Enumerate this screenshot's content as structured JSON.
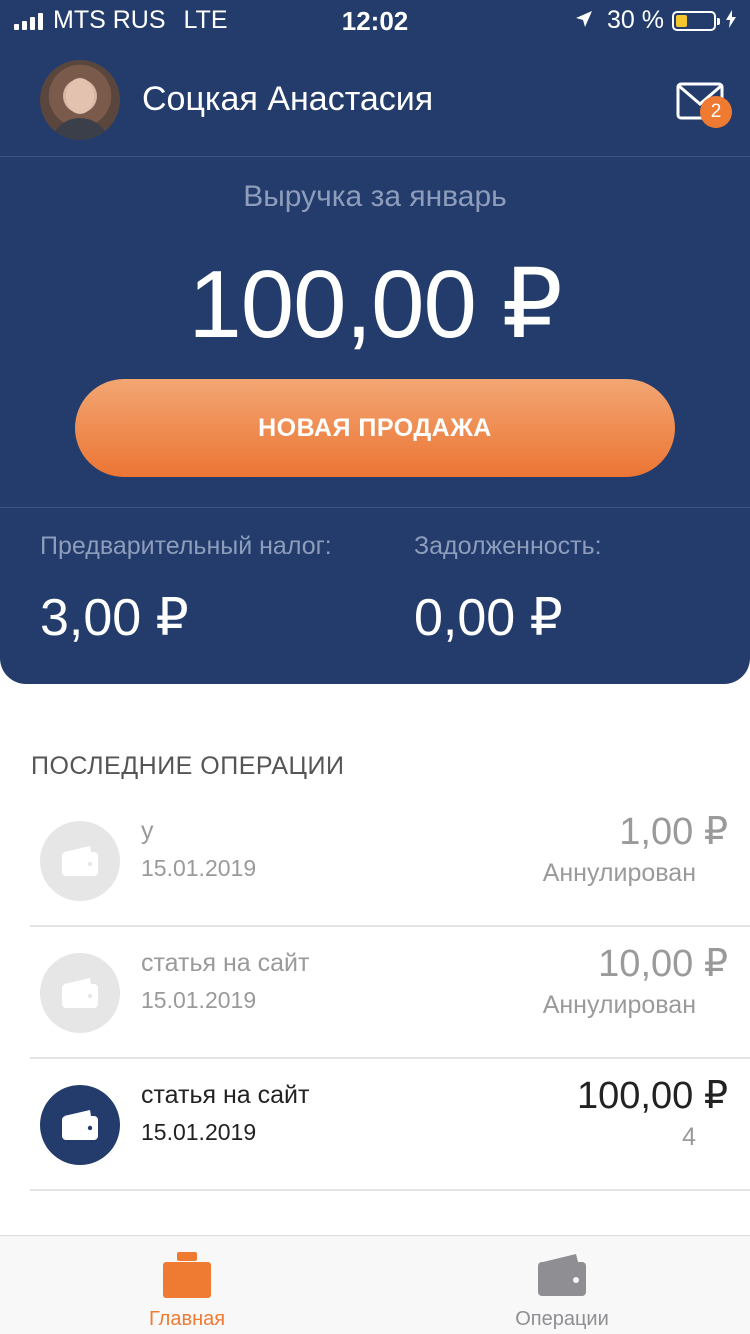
{
  "status_bar": {
    "carrier": "MTS RUS",
    "network": "LTE",
    "time": "12:02",
    "battery": "30 %",
    "battery_level": 0.3
  },
  "profile": {
    "name": "Соцкая Анастасия",
    "mail_badge": "2"
  },
  "revenue": {
    "label": "Выручка за январь",
    "amount": "100,00 ₽",
    "button_label": "НОВАЯ ПРОДАЖА"
  },
  "summary": {
    "tax_label": "Предварительный налог:",
    "tax_value": "3,00 ₽",
    "debt_label": "Задолженность:",
    "debt_value": "0,00 ₽"
  },
  "operations": {
    "title": "ПОСЛЕДНИЕ ОПЕРАЦИИ",
    "items": [
      {
        "title": "у",
        "date": "15.01.2019",
        "amount": "1,00 ₽",
        "status": "Аннулирован"
      },
      {
        "title": "статья на сайт",
        "date": "15.01.2019",
        "amount": "10,00 ₽",
        "status": "Аннулирован"
      },
      {
        "title": "статья на сайт",
        "date": "15.01.2019",
        "amount": "100,00 ₽",
        "status": "4"
      }
    ]
  },
  "tabbar": {
    "home_label": "Главная",
    "ops_label": "Операции"
  },
  "colors": {
    "header_bg": "#233c6b",
    "accent_orange": "#ef7a32",
    "muted_text": "#9a9a9a"
  },
  "icons": {
    "mail": "envelope-icon",
    "wallet": "wallet-icon",
    "home": "briefcase-icon"
  }
}
